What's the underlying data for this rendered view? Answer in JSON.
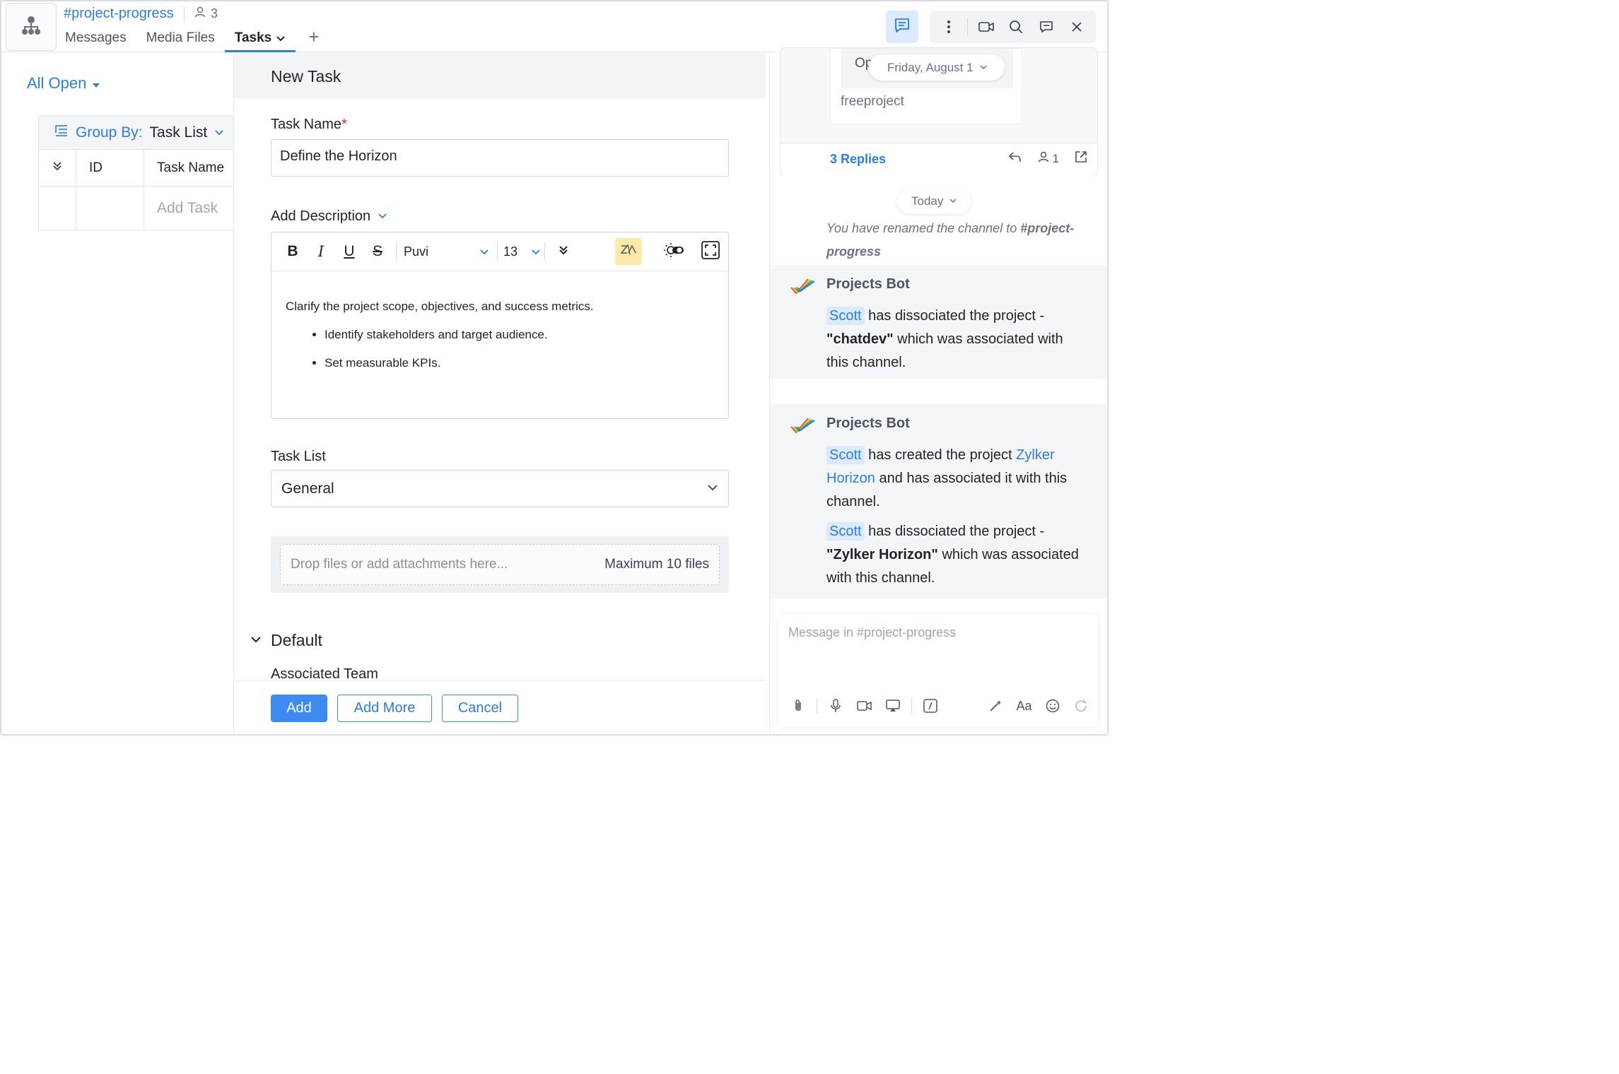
{
  "header": {
    "channel_name": "#project-progress",
    "member_count": "3",
    "tabs": [
      {
        "label": "Messages"
      },
      {
        "label": "Media Files"
      },
      {
        "label": "Tasks"
      }
    ],
    "add_tab": "+"
  },
  "task_list_panel": {
    "filter": "All Open",
    "group_by_label": "Group By:",
    "group_by_value": "Task List",
    "columns": [
      "ID",
      "Task Name"
    ],
    "add_task": "Add Task"
  },
  "new_task_form": {
    "title": "New Task",
    "task_name_label": "Task Name",
    "required_mark": "*",
    "task_name_value": "Define the Horizon",
    "description_label": "Add Description",
    "toolbar": {
      "bold": "B",
      "italic": "I",
      "underline": "U",
      "strike": "S",
      "font": "Puvi",
      "size": "13"
    },
    "description": {
      "paragraph": "Clarify the project scope, objectives, and success metrics.",
      "bullets": [
        "Identify stakeholders and target audience.",
        "Set measurable KPIs."
      ]
    },
    "task_list_label": "Task List",
    "task_list_value": "General",
    "drop_placeholder": "Drop files or add attachments here...",
    "drop_max": "Maximum 10 files",
    "section_default": "Default",
    "associated_team_label": "Associated Team",
    "buttons": {
      "add": "Add",
      "add_more": "Add More",
      "cancel": "Cancel"
    }
  },
  "chat_panel": {
    "thread_card": {
      "partial_text": "Op",
      "date_pill": "Friday, August 1",
      "project": "freeproject",
      "replies": "3 Replies",
      "participants": "1"
    },
    "today_pill": "Today",
    "system_message": {
      "prefix": "You have renamed the channel to ",
      "channel": "#project-progress"
    },
    "bot_messages": [
      {
        "sender": "Projects Bot",
        "mention": "Scott",
        "text_1": " has dissociated the project - ",
        "project": "\"chatdev\"",
        "text_2": " which was associated with this channel."
      },
      {
        "sender": "Projects Bot",
        "mention": "Scott",
        "text_1": " has created the project ",
        "project_link": "Zylker Horizon",
        "text_2": " and has associated it with this channel.",
        "mention_2": "Scott",
        "text_3": " has dissociated the project - ",
        "project_2": "\"Zylker Horizon\"",
        "text_4": " which was associated with this channel."
      }
    ],
    "composer_placeholder": "Message in #project-progress",
    "format_label": "Aa"
  },
  "colors": {
    "accent": "#2b7de9",
    "primary_button": "#3d8bf0",
    "mention_bg": "#dbeafe",
    "zia_bg": "#fde9a8"
  },
  "icons": [
    "org-chart-icon",
    "member-icon",
    "chevron-down-icon",
    "plus-icon",
    "chat-icon",
    "more-vertical-icon",
    "video-call-icon",
    "search-icon",
    "comment-icon",
    "close-icon",
    "group-list-icon",
    "collapse-all-icon",
    "bold-icon",
    "italic-icon",
    "underline-icon",
    "strikethrough-icon",
    "zia-icon",
    "theme-toggle-icon",
    "fullscreen-icon",
    "reply-icon",
    "share-icon",
    "projects-bot-icon",
    "attachment-icon",
    "mic-icon",
    "video-icon",
    "screen-share-icon",
    "slash-command-icon",
    "magic-wand-icon",
    "emoji-icon",
    "refresh-icon"
  ]
}
